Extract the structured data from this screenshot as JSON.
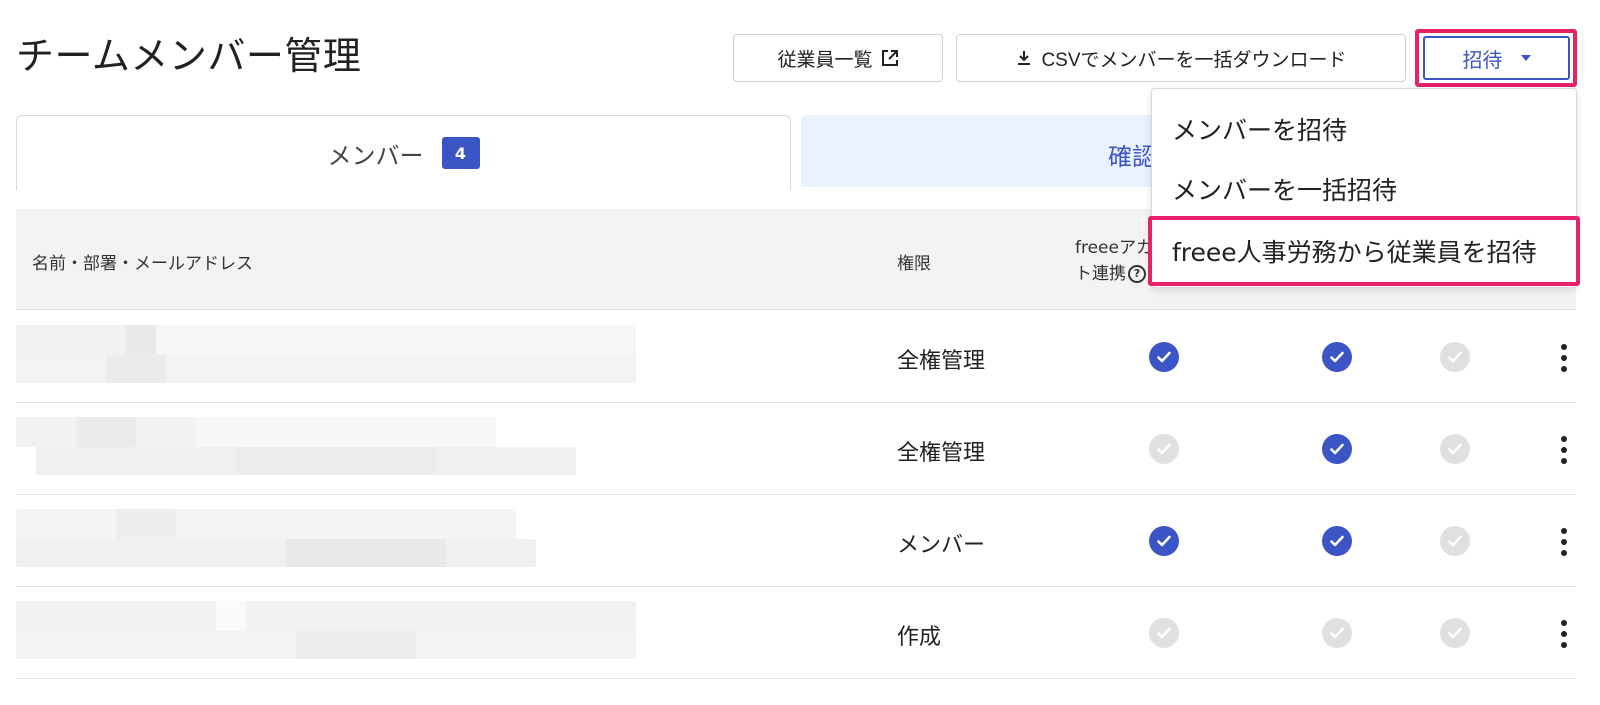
{
  "header": {
    "title": "チームメンバー管理",
    "employees_button": "従業員一覧",
    "csv_button": "CSVでメンバーを一括ダウンロード",
    "invite_button": "招待"
  },
  "tabs": {
    "members_label": "メンバー",
    "members_count": "4",
    "confirm_label": "確認"
  },
  "table": {
    "col_name": "名前・部署・メールアドレス",
    "col_role": "権限",
    "col_freee_line1": "freeeアカウン",
    "col_freee_line2": "ト連携",
    "rows": [
      {
        "role": "全権管理",
        "checks": [
          true,
          true,
          false
        ]
      },
      {
        "role": "全権管理",
        "checks": [
          false,
          true,
          false
        ]
      },
      {
        "role": "メンバー",
        "checks": [
          true,
          true,
          false
        ]
      },
      {
        "role": "作成",
        "checks": [
          false,
          false,
          false
        ]
      }
    ]
  },
  "invite_menu": {
    "items": [
      "メンバーを招待",
      "メンバーを一括招待",
      "freee人事労務から従業員を招待"
    ]
  },
  "colors": {
    "accent": "#3b54c6",
    "highlight": "#e8226a",
    "tab_inactive_bg": "#ebf2fe",
    "check_off": "#e0e0e0"
  }
}
